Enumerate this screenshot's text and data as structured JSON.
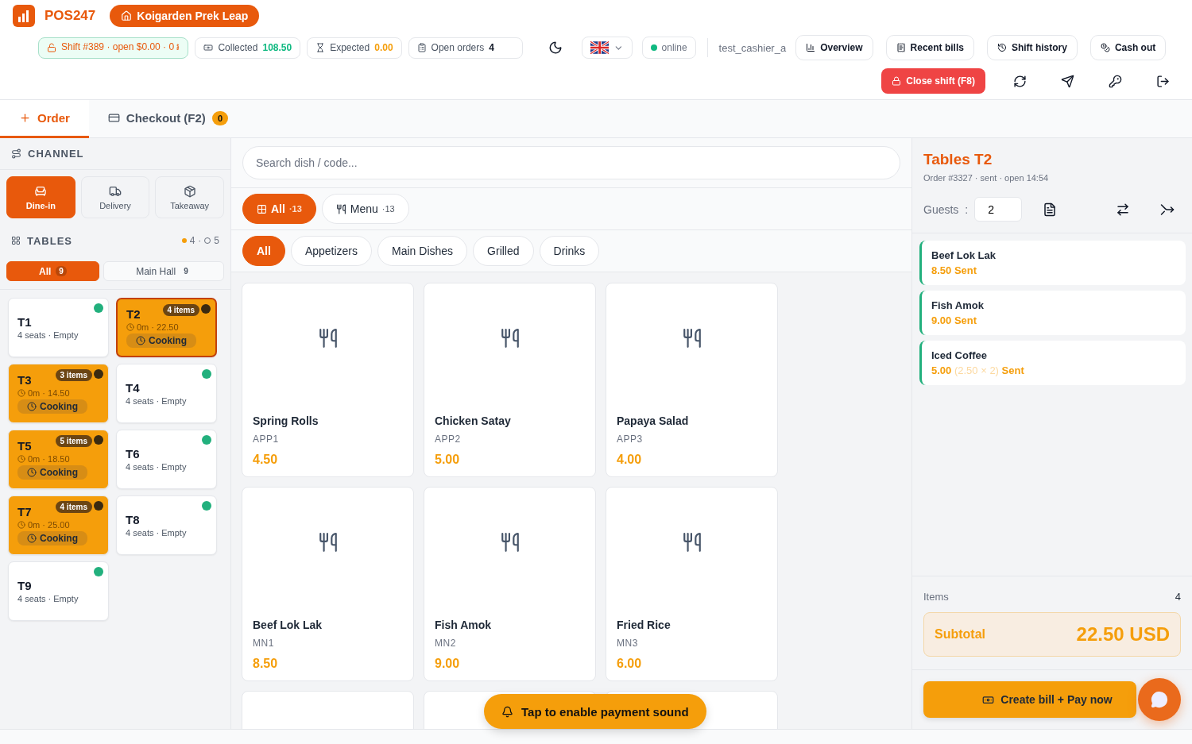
{
  "brand": {
    "name": "POS247",
    "location": "Koigarden Prek Leap"
  },
  "stats": [
    {
      "kind": "shift",
      "label": "Shift #389 · open $0.00 · 0 ៛"
    },
    {
      "kind": "collected",
      "label": "Collected",
      "value": "108.50"
    },
    {
      "kind": "expected",
      "label": "Expected",
      "value": "0.00"
    },
    {
      "kind": "orders",
      "label": "Open orders",
      "value": "4"
    }
  ],
  "status": {
    "label": "online",
    "online": true
  },
  "user": "test_cashier_a",
  "nav_buttons": [
    {
      "kind": "overview",
      "label": "Overview"
    },
    {
      "kind": "bills",
      "label": "Recent bills"
    },
    {
      "kind": "history",
      "label": "Shift history"
    },
    {
      "kind": "cash",
      "label": "Cash out"
    }
  ],
  "close_shift": "Close shift (F8)",
  "tabs": [
    {
      "kind": "order",
      "label": "Order",
      "selected": true
    },
    {
      "kind": "checkout",
      "label": "Checkout (F2)",
      "badge": "0",
      "selected": false
    }
  ],
  "channel": {
    "title": "CHANNEL",
    "options": [
      {
        "kind": "dine",
        "label": "Dine-in",
        "selected": true
      },
      {
        "kind": "delivery",
        "label": "Delivery",
        "selected": false
      },
      {
        "kind": "takeaway",
        "label": "Takeaway",
        "selected": false
      }
    ]
  },
  "tables_section": {
    "title": "TABLES",
    "busy": "4",
    "separator": "·",
    "free": "5",
    "filters": [
      {
        "label": "All",
        "count": "9",
        "selected": true
      },
      {
        "label": "Main Hall",
        "count": "9",
        "selected": false
      }
    ]
  },
  "tables": [
    {
      "kind": "empty",
      "name": "T1",
      "info": "4 seats · Empty",
      "color": "#22b07d",
      "selected": false
    },
    {
      "kind": "busy",
      "name": "T2",
      "items": "4 items",
      "info": "0m · 22.50",
      "status": "Cooking",
      "color": "#3a2a10",
      "selected": true
    },
    {
      "kind": "busy",
      "name": "T3",
      "items": "3 items",
      "info": "0m · 14.50",
      "status": "Cooking",
      "color": "#3a2a10",
      "selected": false
    },
    {
      "kind": "empty",
      "name": "T4",
      "info": "4 seats · Empty",
      "color": "#22b07d",
      "selected": false
    },
    {
      "kind": "busy",
      "name": "T5",
      "items": "5 items",
      "info": "0m · 18.50",
      "status": "Cooking",
      "color": "#3a2a10",
      "selected": false
    },
    {
      "kind": "empty",
      "name": "T6",
      "info": "4 seats · Empty",
      "color": "#22b07d",
      "selected": false
    },
    {
      "kind": "busy",
      "name": "T7",
      "items": "4 items",
      "info": "0m · 25.00",
      "status": "Cooking",
      "color": "#3a2a10",
      "selected": false
    },
    {
      "kind": "empty",
      "name": "T8",
      "info": "4 seats · Empty",
      "color": "#22b07d",
      "selected": false
    },
    {
      "kind": "empty",
      "name": "T9",
      "info": "4 seats · Empty",
      "color": "#22b07d",
      "selected": false
    }
  ],
  "search": {
    "placeholder": "Search dish / code..."
  },
  "menus": [
    {
      "kind": "all",
      "label": "All",
      "count": "·13",
      "selected": true
    },
    {
      "kind": "menu",
      "label": "Menu",
      "count": "·13",
      "selected": false
    }
  ],
  "categories": [
    {
      "label": "All",
      "selected": true
    },
    {
      "label": "Appetizers",
      "selected": false
    },
    {
      "label": "Main Dishes",
      "selected": false
    },
    {
      "label": "Grilled",
      "selected": false
    },
    {
      "label": "Drinks",
      "selected": false
    }
  ],
  "dishes": [
    {
      "kind": "full",
      "name": "Spring Rolls",
      "code": "APP1",
      "price": "4.50"
    },
    {
      "kind": "full",
      "name": "Chicken Satay",
      "code": "APP2",
      "price": "5.00"
    },
    {
      "kind": "full",
      "name": "Papaya Salad",
      "code": "APP3",
      "price": "4.00"
    },
    {
      "kind": "full",
      "name": "Beef Lok Lak",
      "code": "MN1",
      "price": "8.50"
    },
    {
      "kind": "full",
      "name": "Fish Amok",
      "code": "MN2",
      "price": "9.00"
    },
    {
      "kind": "full",
      "name": "Fried Rice",
      "code": "MN3",
      "price": "6.00"
    },
    {
      "kind": "partial"
    },
    {
      "kind": "partial"
    },
    {
      "kind": "partial"
    }
  ],
  "order": {
    "title": "Tables T2",
    "meta": "Order #3327 · sent · open 14:54",
    "guests_label": "Guests",
    "guests_sep": ":",
    "guests": "2",
    "items": [
      {
        "name": "Beef Lok Lak",
        "price": "8.50",
        "status": "Sent"
      },
      {
        "name": "Fish Amok",
        "price": "9.00",
        "status": "Sent"
      },
      {
        "name": "Iced Coffee",
        "price": "5.00",
        "detail": "(2.50 × 2)",
        "status": "Sent"
      }
    ],
    "items_label": "Items",
    "items_count": "4",
    "subtotal_label": "Subtotal",
    "subtotal": "22.50 USD",
    "pay": "Create bill + Pay now"
  },
  "toast": "Tap to enable payment sound"
}
